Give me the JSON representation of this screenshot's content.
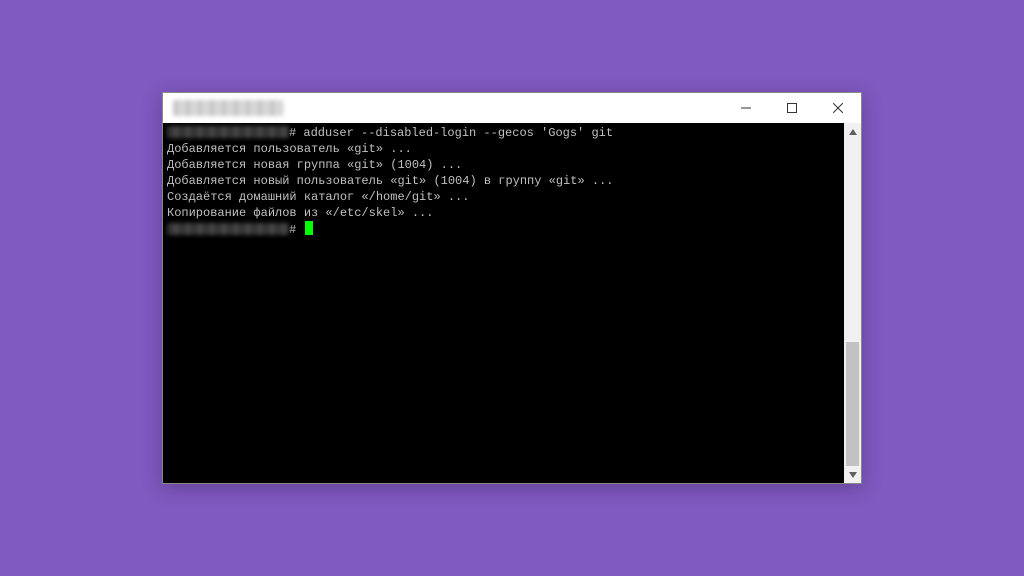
{
  "window": {
    "title_obscured": true
  },
  "terminal": {
    "prompt_symbol": "#",
    "command": "adduser --disabled-login --gecos 'Gogs' git",
    "lines": [
      "Добавляется пользователь «git» ...",
      "Добавляется новая группа «git» (1004) ...",
      "Добавляется новый пользователь «git» (1004) в группу «git» ...",
      "Создаётся домашний каталог «/home/git» ...",
      "Копирование файлов из «/etc/skel» ..."
    ]
  },
  "scrollbar": {
    "thumb_top_pct": 62,
    "thumb_height_pct": 38
  }
}
